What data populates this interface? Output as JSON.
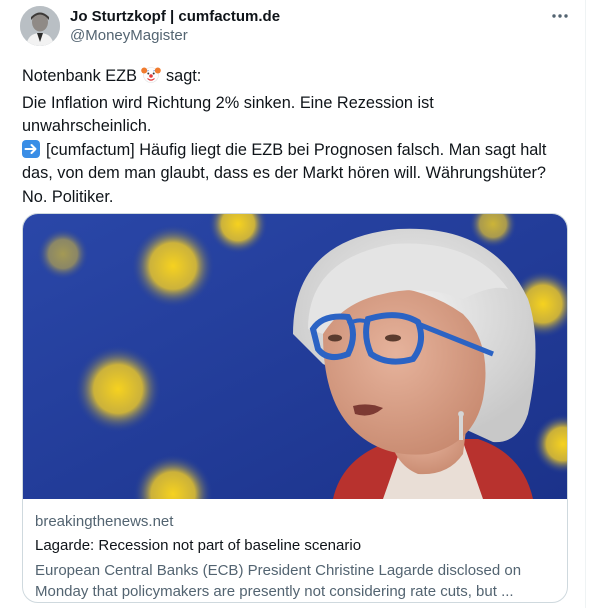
{
  "author": {
    "display_name": "Jo Sturtzkopf | cumfactum.de",
    "handle": "@MoneyMagister"
  },
  "tweet": {
    "line1_prefix": "Notenbank EZB",
    "line1_suffix": "sagt:",
    "line2": "Die Inflation wird Richtung 2% sinken. Eine Rezession ist",
    "line3": "unwahrscheinlich.",
    "line4": "[cumfactum] Häufig liegt die EZB bei Prognosen falsch. Man sagt halt",
    "line5": "das, von dem man glaubt, dass es der Markt hören will. Währungshüter?",
    "line6": "No. Politiker."
  },
  "link_card": {
    "domain": "breakingthenews.net",
    "title": "Lagarde: Recession not part of baseline scenario",
    "description_line1": "European Central Banks (ECB) President Christine Lagarde disclosed on",
    "description_line2": "Monday that policymakers are presently not considering rate cuts, but ..."
  },
  "icons": {
    "more": "more-options-icon",
    "emoji": "clown-face-emoji",
    "arrow": "right-arrow-emoji"
  },
  "colors": {
    "text": "#0f1419",
    "secondary": "#536471",
    "border": "#cfd9de",
    "eu_blue": "#1f3c9a",
    "eu_star": "#f4cf1f"
  }
}
